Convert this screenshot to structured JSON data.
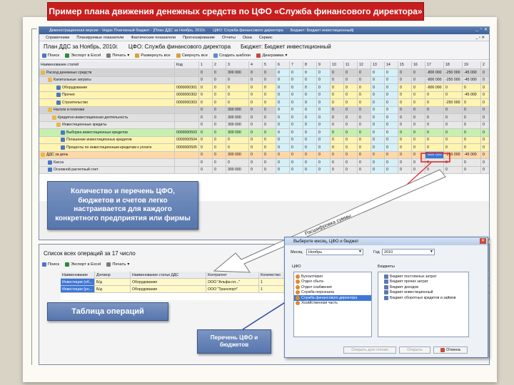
{
  "slide": {
    "title": "Пример плана движения денежных средств по ЦФО «Служба финансового директора»"
  },
  "app": {
    "titlebar": {
      "text": "Демонстрационная версия - Vegas Платежный бюджет - [План ДДС за Ноябрь, 2010г.",
      "cfo": "ЦФО:  Служба финансового директора",
      "budget": "Бюджет:  Бюджет инвестиционный]"
    },
    "menu": [
      "Справочники",
      "Планируемые показатели",
      "Фактические показатели",
      "Прогнозирование",
      "Отчеты",
      "Окна",
      "Сервис"
    ],
    "menu_right": "_ ▫ ✕",
    "plan": {
      "title": "План ДДС за Ноябрь, 2010г.",
      "cfo": "ЦФО:  Служба финансового директора",
      "budget": "Бюджет:  Бюджет инвестиционный"
    },
    "toolbar": [
      "Поиск",
      "Экспорт в Excel",
      "Печать",
      "Развернуть все",
      "Свернуть все",
      "Создать шаблон",
      "Диаграмма"
    ],
    "grid": {
      "headers": [
        "Наименование статей",
        "Код",
        "1",
        "2",
        "3",
        "4",
        "5",
        "6",
        "7",
        "8",
        "9",
        "10",
        "11",
        "12",
        "13",
        "14",
        "15",
        "16",
        "17",
        "18",
        "19",
        "2"
      ],
      "rows": [
        {
          "name": "Расход денежных средств",
          "code": "",
          "vals": [
            "0",
            "0",
            "300 000",
            "0",
            "0",
            "0",
            "0",
            "0",
            "0",
            "0",
            "0",
            "0",
            "0",
            "0",
            "0",
            "0",
            "-800 000",
            "-250 000",
            "-45 000",
            "0"
          ]
        },
        {
          "name": "Капитальные затраты",
          "code": "",
          "vals": [
            "0",
            "0",
            "0",
            "0",
            "0",
            "0",
            "0",
            "0",
            "0",
            "0",
            "0",
            "0",
            "0",
            "0",
            "0",
            "0",
            "-800 000",
            "-250 000",
            "-45 000",
            "0"
          ]
        },
        {
          "name": "Оборудование",
          "code": "0000000301",
          "vals": [
            "0",
            "0",
            "0",
            "0",
            "0",
            "0",
            "0",
            "0",
            "0",
            "0",
            "0",
            "0",
            "0",
            "0",
            "0",
            "0",
            "-800 000",
            "0",
            "0",
            "0"
          ]
        },
        {
          "name": "Прочее",
          "code": "0000000302",
          "vals": [
            "0",
            "0",
            "0",
            "0",
            "0",
            "0",
            "0",
            "0",
            "0",
            "0",
            "0",
            "0",
            "0",
            "0",
            "0",
            "0",
            "0",
            "0",
            "-45 000",
            "0"
          ]
        },
        {
          "name": "Строительство",
          "code": "0000000303",
          "vals": [
            "0",
            "0",
            "0",
            "0",
            "0",
            "0",
            "0",
            "0",
            "0",
            "0",
            "0",
            "0",
            "0",
            "0",
            "0",
            "0",
            "0",
            "-250 000",
            "0",
            "0"
          ]
        },
        {
          "name": "Налоги и платежи",
          "code": "",
          "vals": [
            "0",
            "0",
            "300 000",
            "0",
            "0",
            "0",
            "0",
            "0",
            "0",
            "0",
            "0",
            "0",
            "0",
            "0",
            "0",
            "0",
            "0",
            "0",
            "0",
            "0"
          ]
        },
        {
          "name": "Кредитно-инвестиционная деятельность",
          "code": "",
          "vals": [
            "0",
            "0",
            "300 000",
            "0",
            "0",
            "0",
            "0",
            "0",
            "0",
            "0",
            "0",
            "0",
            "0",
            "0",
            "0",
            "0",
            "0",
            "0",
            "0",
            "0"
          ]
        },
        {
          "name": "Инвестиционные кредиты",
          "code": "",
          "vals": [
            "0",
            "0",
            "300 000",
            "0",
            "0",
            "0",
            "0",
            "0",
            "0",
            "0",
            "0",
            "0",
            "0",
            "0",
            "0",
            "0",
            "0",
            "0",
            "0",
            "0"
          ]
        },
        {
          "name": "Выборка инвестиционных кредитов",
          "code": "0000000503",
          "vals": [
            "0",
            "0",
            "300 000",
            "0",
            "0",
            "0",
            "0",
            "0",
            "0",
            "0",
            "0",
            "0",
            "0",
            "0",
            "0",
            "0",
            "0",
            "0",
            "0",
            "0"
          ]
        },
        {
          "name": "Погашение инвестиционных кредитов",
          "code": "0000000504",
          "vals": [
            "0",
            "0",
            "0",
            "0",
            "0",
            "0",
            "0",
            "0",
            "0",
            "0",
            "0",
            "0",
            "0",
            "0",
            "0",
            "0",
            "0",
            "0",
            "0",
            "0"
          ]
        },
        {
          "name": "Проценты по инвестиционным кредитам к уплате",
          "code": "0000000505",
          "vals": [
            "0",
            "0",
            "0",
            "0",
            "0",
            "0",
            "0",
            "0",
            "0",
            "0",
            "0",
            "0",
            "0",
            "0",
            "0",
            "0",
            "0",
            "0",
            "0",
            "0"
          ]
        },
        {
          "name": "ДДС за день",
          "code": "",
          "vals": [
            "0",
            "0",
            "300 000",
            "0",
            "0",
            "0",
            "0",
            "0",
            "0",
            "0",
            "0",
            "0",
            "0",
            "0",
            "0",
            "0",
            "-800 000",
            "-250 000",
            "-45 000",
            "0"
          ]
        },
        {
          "name": "Касса",
          "code": "",
          "vals": [
            "0",
            "0",
            "0",
            "0",
            "0",
            "0",
            "0",
            "0",
            "0",
            "0",
            "0",
            "0",
            "0",
            "0",
            "0",
            "0",
            "0",
            "0",
            "0",
            "0"
          ]
        },
        {
          "name": "Основной расчетный счет",
          "code": "",
          "vals": [
            "0",
            "0",
            "300 000",
            "0",
            "0",
            "0",
            "0",
            "0",
            "0",
            "0",
            "0",
            "0",
            "0",
            "0",
            "0",
            "0",
            "0",
            "0",
            "0",
            "0"
          ]
        }
      ]
    }
  },
  "callouts": {
    "main": "Количество и перечень ЦФО, бюджетов и счетов легко настраивается для каждого конкретного предприятия или фирмы",
    "table": "Таблица операций",
    "cfo": "Перечень ЦФО и бюджетов",
    "arrow": "Расшифровка суммы"
  },
  "ops": {
    "title": "Список всех операций за 17 число",
    "toolbar": [
      "Поиск",
      "Экспорт в Excel",
      "Печать"
    ],
    "headers": [
      "Наименование",
      "Договор",
      "Наименование статьи ДДС",
      "Контрагент",
      "Количество",
      "Цена"
    ],
    "rows": [
      [
        "Инвестиции (об...",
        "Б/д",
        "Оборудование",
        "ООО \"Альфа пл...\"",
        "1",
        "750 000"
      ],
      [
        "Инвестиции (ро...",
        "Б/д",
        "Оборудование",
        "ООО \"Транспорт\"",
        "1",
        "50 000"
      ]
    ]
  },
  "dialog": {
    "title": "Выберите месяц, ЦФО и бюджет",
    "month_label": "Месяц",
    "month_value": "Ноябрь",
    "year_label": "Год",
    "year_value": "2010",
    "cfo_label": "ЦФО",
    "budgets_label": "Бюджеты",
    "cfo_list": [
      "Бухгалтерия",
      "Отдел сбыта",
      "Отдел снабжения",
      "Служба персонала",
      "Служба финансового директора",
      "Хозяйственная часть"
    ],
    "budget_list": [
      "Бюджет постоянных затрат",
      "Бюджет прочих затрат",
      "Бюджет доходов",
      "Бюджет инвестиционный",
      "Бюджет оборотных кредитов и займов"
    ],
    "btn_open_view": "Открыть для чтения",
    "btn_open": "Открыть",
    "btn_cancel": "Отмена"
  }
}
